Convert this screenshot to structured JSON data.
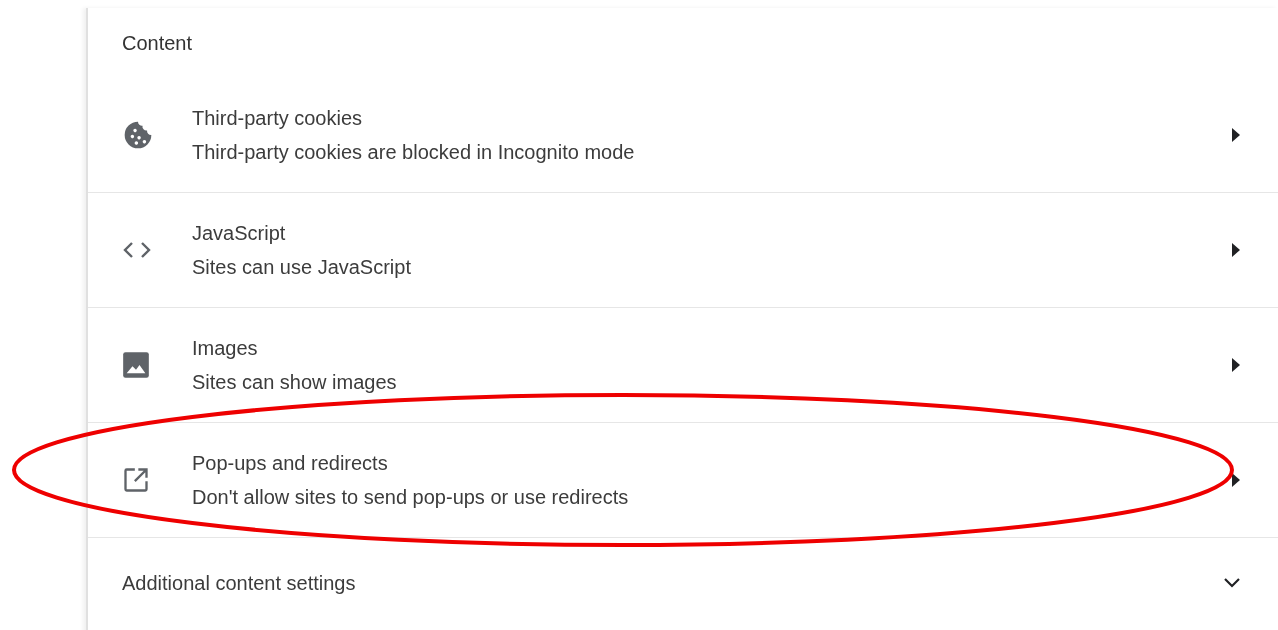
{
  "section": {
    "title": "Content"
  },
  "rows": [
    {
      "title": "Third-party cookies",
      "description": "Third-party cookies are blocked in Incognito mode",
      "highlighted": false
    },
    {
      "title": "JavaScript",
      "description": "Sites can use JavaScript",
      "highlighted": false
    },
    {
      "title": "Images",
      "description": "Sites can show images",
      "highlighted": false
    },
    {
      "title": "Pop-ups and redirects",
      "description": "Don't allow sites to send pop-ups or use redirects",
      "highlighted": true
    }
  ],
  "additional": {
    "label": "Additional content settings",
    "expanded": false
  }
}
